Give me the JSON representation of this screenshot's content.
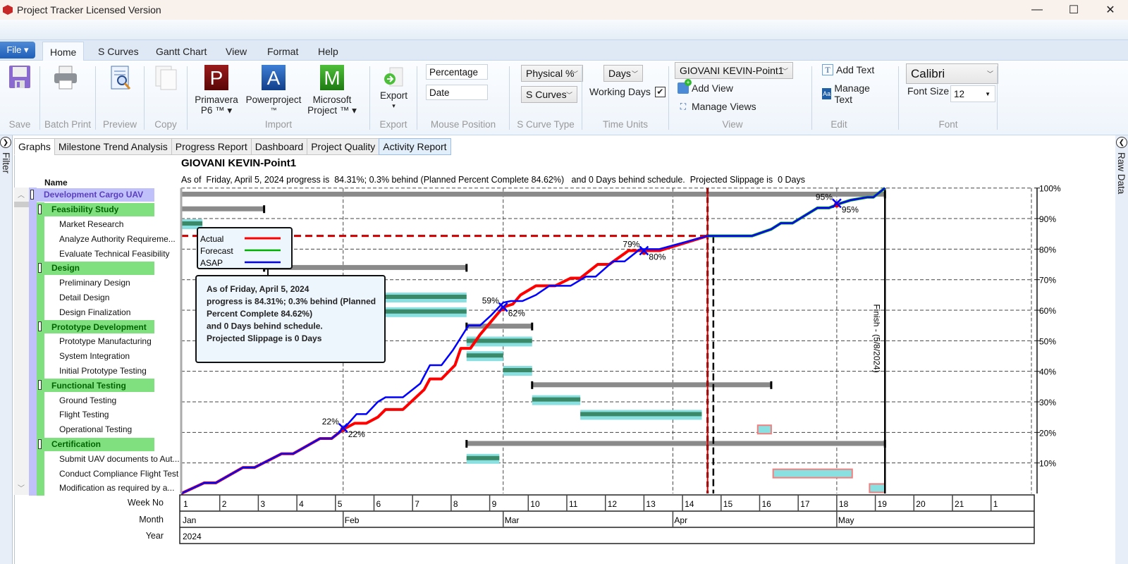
{
  "window": {
    "title": "Project Tracker Licensed Version",
    "minimize": "—",
    "maximize": "☐",
    "close": "✕"
  },
  "ribbon_tabs": {
    "file": "File ▾",
    "tabs": [
      "Home",
      "S Curves",
      "Gantt Chart",
      "View",
      "Format",
      "Help"
    ],
    "active": "Home"
  },
  "ribbon": {
    "save": {
      "label": "",
      "group": "Save"
    },
    "batch_print": {
      "group": "Batch Print"
    },
    "preview": {
      "group": "Preview"
    },
    "copy": {
      "group": "Copy"
    },
    "import": {
      "group": "Import",
      "primavera": "Primavera",
      "primavera2": "P6 ™ ▾",
      "powerproject": "Powerproject",
      "powerproject2": "™",
      "msproject": "Microsoft",
      "msproject2": "Project ™ ▾",
      "p_letter": "P",
      "a_letter": "A",
      "m_letter": "M"
    },
    "export": {
      "group": "Export",
      "label": "Export",
      "arrow": "▾"
    },
    "mouse_position": {
      "group": "Mouse Position",
      "field1": "Percentage",
      "field2": "Date"
    },
    "s_curve_type": {
      "group": "S Curve Type",
      "combo1": "Physical %",
      "combo2": "S Curves"
    },
    "time_units": {
      "group": "Time Units",
      "combo": "Days",
      "working_days_label": "Working Days",
      "working_days_checked": true
    },
    "view": {
      "group": "View",
      "combo": "GIOVANI KEVIN-Point1",
      "add_view": "Add View",
      "manage_views": "Manage Views"
    },
    "edit": {
      "group": "Edit",
      "add_text": "Add Text",
      "manage_text": "Manage Text"
    },
    "font": {
      "group": "Font",
      "font_combo": "Calibri",
      "font_size_label": "Font Size",
      "font_size": "12"
    }
  },
  "side_panels": {
    "left": "Filter",
    "right": "Raw Data"
  },
  "view_tabs": [
    "Graphs",
    "Milestone Trend Analysis",
    "Progress Report",
    "Dashboard",
    "Project Quality",
    "Activity Report"
  ],
  "tree": {
    "header": "Name",
    "rows": [
      {
        "name": "Development Cargo UAV",
        "level": 0,
        "summary": true
      },
      {
        "name": "Feasibility Study",
        "level": 1,
        "summary": true
      },
      {
        "name": "Market Research",
        "level": 2
      },
      {
        "name": "Analyze Authority Requireme...",
        "level": 2
      },
      {
        "name": "Evaluate Technical Feasibility",
        "level": 2
      },
      {
        "name": "Design",
        "level": 1,
        "summary": true
      },
      {
        "name": "Preliminary Design",
        "level": 2
      },
      {
        "name": "Detail Design",
        "level": 2
      },
      {
        "name": "Design Finalization",
        "level": 2
      },
      {
        "name": "Prototype Development",
        "level": 1,
        "summary": true
      },
      {
        "name": "Prototype Manufacturing",
        "level": 2
      },
      {
        "name": "System Integration",
        "level": 2
      },
      {
        "name": "Initial Prototype Testing",
        "level": 2
      },
      {
        "name": "Functional Testing",
        "level": 1,
        "summary": true
      },
      {
        "name": "Ground Testing",
        "level": 2
      },
      {
        "name": "Flight Testing",
        "level": 2
      },
      {
        "name": "Operational Testing",
        "level": 2
      },
      {
        "name": "Certification",
        "level": 1,
        "summary": true
      },
      {
        "name": "Submit UAV documents to Aut...",
        "level": 2
      },
      {
        "name": "Conduct Compliance Flight Test",
        "level": 2
      },
      {
        "name": "Modification as required by a...",
        "level": 2
      }
    ]
  },
  "timescale_labels": {
    "week": "Week No",
    "month": "Month",
    "year": "Year"
  },
  "chart_data": {
    "type": "line",
    "title": "GIOVANI KEVIN-Point1",
    "subtitle": "As of  Friday, April 5, 2024 progress is  84.31%; 0.3% behind (Planned Percent Complete 84.62%)   and 0 Days behind schedule.  Projected Slippage is  0 Days",
    "x_unit": "week",
    "xlim": [
      1,
      22.6
    ],
    "ylim": [
      0,
      100
    ],
    "yticks": [
      "10%",
      "20%",
      "30%",
      "40%",
      "50%",
      "60%",
      "70%",
      "80%",
      "90%",
      "100%"
    ],
    "weeks": [
      "1",
      "2",
      "3",
      "4",
      "5",
      "6",
      "7",
      "8",
      "9",
      "10",
      "11",
      "12",
      "13",
      "14",
      "15",
      "16",
      "17",
      "18",
      "19",
      "20",
      "21",
      "1"
    ],
    "months": [
      {
        "label": "Jan",
        "start": 1
      },
      {
        "label": "Feb",
        "start": 5.2
      },
      {
        "label": "Mar",
        "start": 9.35
      },
      {
        "label": "Apr",
        "start": 13.75
      },
      {
        "label": "May",
        "start": 18.0
      }
    ],
    "years": [
      {
        "label": "2024",
        "start": 1
      }
    ],
    "data_date_week": 14.65,
    "status_dashed_week": 14.8,
    "finish_week": 19.25,
    "finish_label": "Finish - (5/8/2024)",
    "status_percent": 84.31,
    "legend": [
      {
        "name": "Actual",
        "color": "#ff0000"
      },
      {
        "name": "Forecast",
        "color": "#00b000"
      },
      {
        "name": "ASAP",
        "color": "#0000ff"
      }
    ],
    "info_box": [
      "As of  Friday, April 5, 2024",
      "progress is  84.31%; 0.3% behind (Planned",
      "Percent Complete 84.62%)",
      "and 0 Days behind schedule.",
      "Projected Slippage is  0 Days"
    ],
    "series": [
      {
        "name": "Actual",
        "color": "#ff0000",
        "points": [
          [
            1,
            0
          ],
          [
            1.6,
            3.5
          ],
          [
            1.9,
            3.5
          ],
          [
            2.6,
            8.5
          ],
          [
            2.9,
            8.5
          ],
          [
            3.6,
            13
          ],
          [
            3.9,
            13
          ],
          [
            4.6,
            18
          ],
          [
            4.9,
            18
          ],
          [
            5.2,
            21
          ],
          [
            5.5,
            23
          ],
          [
            5.8,
            23
          ],
          [
            6.1,
            25
          ],
          [
            6.3,
            27.5
          ],
          [
            6.75,
            27.5
          ],
          [
            7.3,
            34
          ],
          [
            7.45,
            37.5
          ],
          [
            7.75,
            37.5
          ],
          [
            8.1,
            42
          ],
          [
            8.25,
            47.5
          ],
          [
            8.5,
            47.5
          ],
          [
            8.75,
            52
          ],
          [
            8.95,
            55
          ],
          [
            9.15,
            58
          ],
          [
            9.35,
            61
          ],
          [
            9.6,
            62
          ],
          [
            9.8,
            65
          ],
          [
            10.2,
            68
          ],
          [
            10.7,
            68
          ],
          [
            11.1,
            70.5
          ],
          [
            11.35,
            70.5
          ],
          [
            11.8,
            75
          ],
          [
            12.1,
            75
          ],
          [
            12.6,
            79.5
          ],
          [
            13.4,
            79.5
          ],
          [
            14.65,
            84.31
          ]
        ]
      },
      {
        "name": "ASAP",
        "color": "#0000ff",
        "points": [
          [
            1,
            0
          ],
          [
            1.6,
            3.5
          ],
          [
            1.9,
            3.5
          ],
          [
            2.6,
            8.5
          ],
          [
            2.9,
            8.5
          ],
          [
            3.6,
            13
          ],
          [
            3.9,
            13
          ],
          [
            4.6,
            18
          ],
          [
            4.9,
            18
          ],
          [
            5.2,
            21
          ],
          [
            5.55,
            26
          ],
          [
            5.8,
            26
          ],
          [
            6.1,
            30
          ],
          [
            6.3,
            31.5
          ],
          [
            6.75,
            31.5
          ],
          [
            7.2,
            36
          ],
          [
            7.45,
            42
          ],
          [
            7.75,
            42
          ],
          [
            8.05,
            47
          ],
          [
            8.25,
            51
          ],
          [
            8.45,
            55
          ],
          [
            8.75,
            55
          ],
          [
            9.05,
            58.5
          ],
          [
            9.35,
            62.5
          ],
          [
            9.55,
            63
          ],
          [
            9.85,
            63
          ],
          [
            10.2,
            65
          ],
          [
            10.55,
            68
          ],
          [
            11.1,
            68
          ],
          [
            11.5,
            71
          ],
          [
            11.75,
            71
          ],
          [
            12.2,
            76
          ],
          [
            12.5,
            76
          ],
          [
            12.9,
            80
          ],
          [
            13.4,
            80
          ],
          [
            14.65,
            84.31
          ]
        ]
      },
      {
        "name": "Forecast",
        "color": "#00b000",
        "points": [
          [
            14.65,
            84.31
          ],
          [
            15.8,
            84.31
          ],
          [
            16.3,
            86.5
          ],
          [
            16.55,
            88.5
          ],
          [
            16.85,
            88.5
          ],
          [
            17.5,
            93.5
          ],
          [
            17.8,
            93.5
          ],
          [
            18.1,
            95
          ],
          [
            18.35,
            96
          ],
          [
            18.8,
            97
          ],
          [
            18.95,
            97
          ],
          [
            19.25,
            100
          ]
        ]
      },
      {
        "name": "ASAP-forecast",
        "color": "#0000ff",
        "points": [
          [
            14.65,
            84.31
          ],
          [
            15.8,
            84.31
          ],
          [
            16.3,
            86.5
          ],
          [
            16.55,
            88.5
          ],
          [
            16.85,
            88.5
          ],
          [
            17.5,
            93.5
          ],
          [
            17.8,
            93.5
          ],
          [
            18.1,
            95
          ],
          [
            18.35,
            96
          ],
          [
            18.8,
            97
          ],
          [
            18.95,
            97
          ],
          [
            19.25,
            100
          ]
        ]
      }
    ],
    "markers": [
      {
        "week": 5.2,
        "percent": 21.5,
        "label_left": "22%",
        "label_right": "22%"
      },
      {
        "week": 9.35,
        "percent": 61,
        "label_left": "59%",
        "label_right": "62%"
      },
      {
        "week": 13.0,
        "percent": 79.5,
        "label_left": "79%",
        "label_right": "80%"
      },
      {
        "week": 18.0,
        "percent": 95,
        "label_left": "95%",
        "label_right": "95%"
      }
    ],
    "gantt_bars": [
      {
        "row": 0,
        "type": "summary",
        "start": 1,
        "end": 19.25
      },
      {
        "row": 1,
        "type": "summary",
        "start": 1,
        "end": 3.15
      },
      {
        "row": 2,
        "type": "task",
        "start": 1,
        "end": 1.55,
        "progress": 1
      },
      {
        "row": 5,
        "type": "summary",
        "start": 3.15,
        "end": 8.4
      },
      {
        "row": 7,
        "type": "task",
        "start": 5.55,
        "end": 8.4,
        "progress": 1
      },
      {
        "row": 8,
        "type": "task",
        "start": 5.55,
        "end": 8.4,
        "progress": 1
      },
      {
        "row": 9,
        "type": "summary",
        "start": 8.4,
        "end": 10.1
      },
      {
        "row": 10,
        "type": "task",
        "start": 8.4,
        "end": 10.1,
        "progress": 1
      },
      {
        "row": 11,
        "type": "task",
        "start": 8.4,
        "end": 9.35,
        "progress": 1
      },
      {
        "row": 12,
        "type": "task",
        "start": 9.35,
        "end": 10.1,
        "progress": 1
      },
      {
        "row": 13,
        "type": "summary",
        "start": 10.1,
        "end": 16.3
      },
      {
        "row": 14,
        "type": "task",
        "start": 10.1,
        "end": 11.35,
        "progress": 1
      },
      {
        "row": 15,
        "type": "task",
        "start": 11.35,
        "end": 14.5,
        "progress": 1
      },
      {
        "row": 16,
        "type": "future",
        "start": 15.95,
        "end": 16.3,
        "progress": 0
      },
      {
        "row": 17,
        "type": "summary",
        "start": 8.4,
        "end": 19.25
      },
      {
        "row": 18,
        "type": "task",
        "start": 8.4,
        "end": 9.25,
        "progress": 1
      },
      {
        "row": 19,
        "type": "future",
        "start": 16.35,
        "end": 18.4,
        "progress": 0
      },
      {
        "row": 20,
        "type": "future",
        "start": 18.85,
        "end": 19.25,
        "progress": 0
      }
    ]
  }
}
